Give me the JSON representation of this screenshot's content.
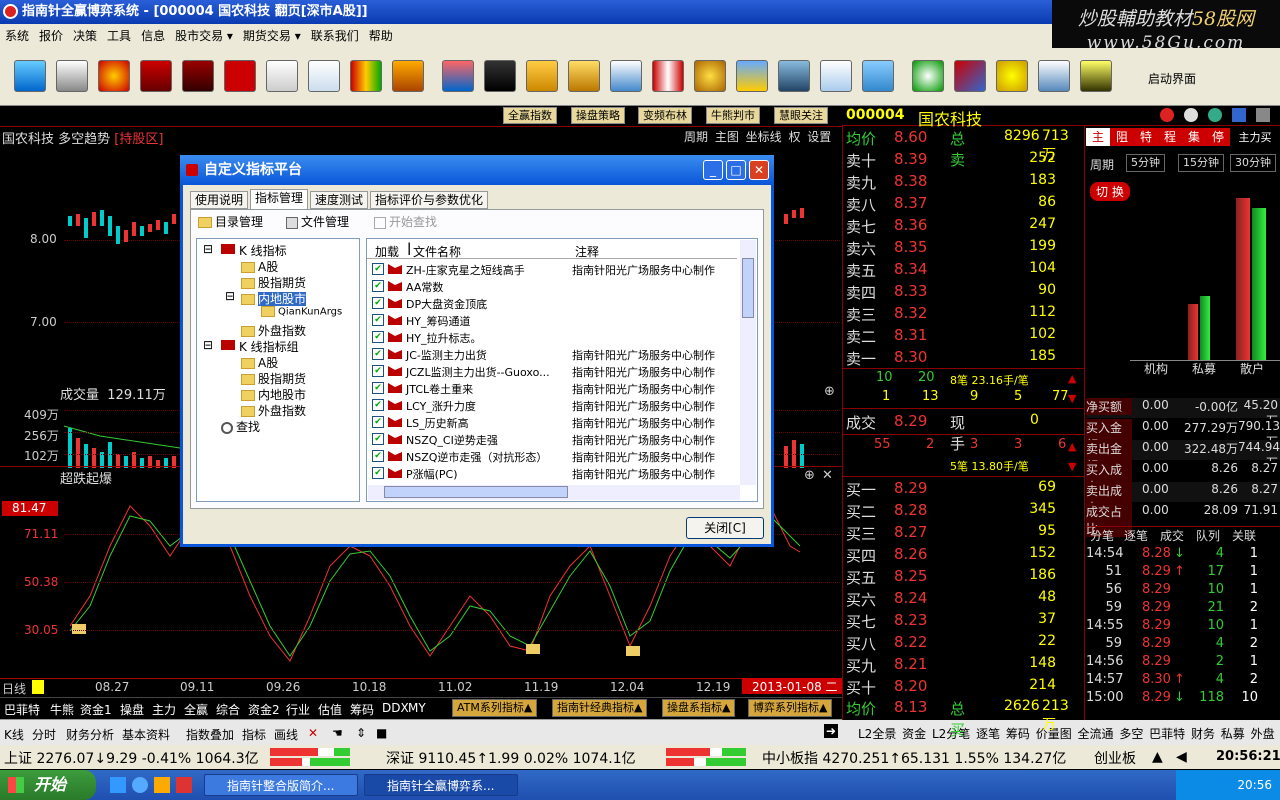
{
  "window_title": "指南针全赢博弈系统 - [000004 国农科技 翻页[深市A股]]",
  "watermark": {
    "line1_a": "炒股輔助教材",
    "line1_b": "58股网",
    "line2": "www.58Gu.com"
  },
  "menu": [
    "系统",
    "报价",
    "决策",
    "工具",
    "信息",
    "股市交易 ▾",
    "期货交易 ▾",
    "联系我们",
    "帮助"
  ],
  "toolbar_label": "启动界面",
  "strategy_buttons": [
    "全赢指数",
    "操盘策略",
    "变频布林",
    "牛熊判市",
    "慧眼关注"
  ],
  "chart": {
    "title": "国农科技 多空趋势",
    "hold": "[持股区]",
    "menu": "周期 主图 坐标线 权 设置",
    "price_labels": [
      "8.00",
      "7.00"
    ],
    "volume_title": "成交量",
    "volume_value": "129.11万",
    "volume_labels": [
      "409万",
      "256万",
      "102万"
    ],
    "osc_title": "超跌起爆",
    "osc_value": "81.47",
    "osc_labels": [
      "71.11",
      "50.38",
      "30.05"
    ],
    "x_ticks": [
      "日线",
      "08.27",
      "09.11",
      "09.26",
      "10.18",
      "11.02",
      "11.19",
      "12.04",
      "12.19"
    ],
    "date_badge": "2013-01-08 二"
  },
  "indicator_bar": [
    "巴菲特",
    "牛熊",
    "资金1",
    "操盘",
    "主力",
    "全赢",
    "综合",
    "资金2",
    "行业",
    "估值",
    "筹码",
    "DDX",
    "MY"
  ],
  "indicator_buttons": [
    "ATM系列指标▲",
    "指南针经典指标▲",
    "操盘系指标▲",
    "博弈系列指标▲"
  ],
  "subtabs": [
    "K线",
    "分时",
    "财务分析",
    "基本资料",
    "指数叠加",
    "指标",
    "画线"
  ],
  "right_bottom_tabs": "L2全景 资金 L2分笔 逐笔 筹码 价量图 全流通 多空 巴菲特 财务 私募 外盘",
  "status": {
    "sh": "上证 2276.07↓9.29 -0.41% 1064.3亿",
    "sz": "深证 9110.45↑1.99 0.02% 1074.1亿",
    "zxb": "中小板指 4270.251↑65.131 1.55% 134.27亿",
    "cyb": "创业板",
    "clock": "20:56:21"
  },
  "taskbar": {
    "start": "开始",
    "tasks": [
      "指南针整合版简介...",
      "指南针全赢博弈系..."
    ],
    "time": "20:56"
  },
  "quote": {
    "code": "000004",
    "name": "国农科技",
    "avg_label": "均价",
    "avg": "8.60",
    "total_sell_label": "总卖",
    "total_sell": "8296",
    "total_sell_amt": "713万",
    "sells": [
      {
        "l": "卖十",
        "p": "8.39",
        "v": "252"
      },
      {
        "l": "卖九",
        "p": "8.38",
        "v": "183"
      },
      {
        "l": "卖八",
        "p": "8.37",
        "v": "86"
      },
      {
        "l": "卖七",
        "p": "8.36",
        "v": "247"
      },
      {
        "l": "卖六",
        "p": "8.35",
        "v": "199"
      },
      {
        "l": "卖五",
        "p": "8.34",
        "v": "104"
      },
      {
        "l": "卖四",
        "p": "8.33",
        "v": "90"
      },
      {
        "l": "卖三",
        "p": "8.32",
        "v": "112"
      },
      {
        "l": "卖二",
        "p": "8.31",
        "v": "102"
      },
      {
        "l": "卖一",
        "p": "8.30",
        "v": "185"
      }
    ],
    "mid1": [
      "10",
      "20",
      "8笔 23.16手/笔"
    ],
    "mid2": [
      "1",
      "13",
      "9",
      "5",
      "77"
    ],
    "deal_label": "成交",
    "deal": "8.29",
    "now_label": "现手",
    "now": "0",
    "mid3": [
      "55",
      "2",
      "3",
      "3",
      "6"
    ],
    "mid4": "5笔 13.80手/笔",
    "buys": [
      {
        "l": "买一",
        "p": "8.29",
        "v": "69"
      },
      {
        "l": "买二",
        "p": "8.28",
        "v": "345"
      },
      {
        "l": "买三",
        "p": "8.27",
        "v": "95"
      },
      {
        "l": "买四",
        "p": "8.26",
        "v": "152"
      },
      {
        "l": "买五",
        "p": "8.25",
        "v": "186"
      },
      {
        "l": "买六",
        "p": "8.24",
        "v": "48"
      },
      {
        "l": "买七",
        "p": "8.23",
        "v": "37"
      },
      {
        "l": "买八",
        "p": "8.22",
        "v": "22"
      },
      {
        "l": "买九",
        "p": "8.21",
        "v": "148"
      },
      {
        "l": "买十",
        "p": "8.20",
        "v": "214"
      }
    ],
    "avg2": "8.13",
    "total_buy_label": "总买",
    "total_buy": "2626",
    "total_buy_amt": "213万"
  },
  "far_right": {
    "tabs": [
      "主",
      "阻",
      "特",
      "程",
      "集",
      "停"
    ],
    "main_label": "主力买",
    "period_label": "周期",
    "periods": [
      "5分钟",
      "15分钟",
      "30分钟"
    ],
    "cut": "切 换",
    "bar_labels": [
      "机构",
      "私募",
      "散户"
    ],
    "table": [
      {
        "k": "净买额",
        "a": "0.00",
        "b": "-0.00亿",
        "c": "45.20万"
      },
      {
        "k": "买入金额",
        "a": "0.00",
        "b": "277.29万",
        "c": "790.13万"
      },
      {
        "k": "卖出金额",
        "a": "0.00",
        "b": "322.48万",
        "c": "744.94万"
      },
      {
        "k": "买入成本",
        "a": "0.00",
        "b": "8.26",
        "c": "8.27"
      },
      {
        "k": "卖出成本",
        "a": "0.00",
        "b": "8.26",
        "c": "8.27"
      },
      {
        "k": "成交占比",
        "a": "0.00",
        "b": "28.09",
        "c": "71.91"
      }
    ],
    "tick_tabs": [
      "分笔",
      "逐笔",
      "成交",
      "队列",
      "关联"
    ],
    "ticks": [
      {
        "t": "14:54",
        "p": "8.28",
        "d": "↓",
        "v": "4",
        "n": "1"
      },
      {
        "t": "51",
        "p": "8.29",
        "d": "↑",
        "v": "17",
        "n": "1"
      },
      {
        "t": "56",
        "p": "8.29",
        "d": "",
        "v": "10",
        "n": "1"
      },
      {
        "t": "59",
        "p": "8.29",
        "d": "",
        "v": "21",
        "n": "2"
      },
      {
        "t": "14:55",
        "p": "8.29",
        "d": "",
        "v": "10",
        "n": "1"
      },
      {
        "t": "59",
        "p": "8.29",
        "d": "",
        "v": "4",
        "n": "2"
      },
      {
        "t": "14:56",
        "p": "8.29",
        "d": "",
        "v": "2",
        "n": "1"
      },
      {
        "t": "14:57",
        "p": "8.30",
        "d": "↑",
        "v": "4",
        "n": "2"
      },
      {
        "t": "15:00",
        "p": "8.29",
        "d": "↓",
        "v": "118",
        "n": "10"
      }
    ]
  },
  "dialog": {
    "title": "自定义指标平台",
    "tabs": [
      "使用说明",
      "指标管理",
      "速度测试",
      "指标评价与参数优化"
    ],
    "tools": [
      "目录管理",
      "文件管理",
      "开始查找"
    ],
    "tree": [
      "K 线指标",
      "A股",
      "股指期货",
      "内地股市",
      "QianKunArgs",
      "外盘指数",
      "K 线指标组",
      "A股",
      "股指期货",
      "内地股市",
      "外盘指数",
      "查找"
    ],
    "cols": [
      "加载",
      "文件名称",
      "注释"
    ],
    "files": [
      {
        "n": "ZH-庄家克星之短线高手",
        "c": "指南针阳光广场服务中心制作"
      },
      {
        "n": "AA常数",
        "c": ""
      },
      {
        "n": "DP大盘资金顶底",
        "c": ""
      },
      {
        "n": "HY_筹码通道",
        "c": ""
      },
      {
        "n": "HY_拉升标志。",
        "c": ""
      },
      {
        "n": "JC-监测主力出货",
        "c": "指南针阳光广场服务中心制作"
      },
      {
        "n": "JCZL监测主力出货--Guoxo...",
        "c": "指南针阳光广场服务中心制作"
      },
      {
        "n": "JTCL卷土重来",
        "c": "指南针阳光广场服务中心制作"
      },
      {
        "n": "LCY_涨升力度",
        "c": "指南针阳光广场服务中心制作"
      },
      {
        "n": "LS_历史新高",
        "c": "指南针阳光广场服务中心制作"
      },
      {
        "n": "NSZQ_CI逆势走强",
        "c": "指南针阳光广场服务中心制作"
      },
      {
        "n": "NSZQ逆市走强（对抗形态）",
        "c": "指南针阳光广场服务中心制作"
      },
      {
        "n": "P涨幅(PC)",
        "c": "指南针阳光广场服务中心制作"
      }
    ],
    "close": "关闭[C]"
  }
}
